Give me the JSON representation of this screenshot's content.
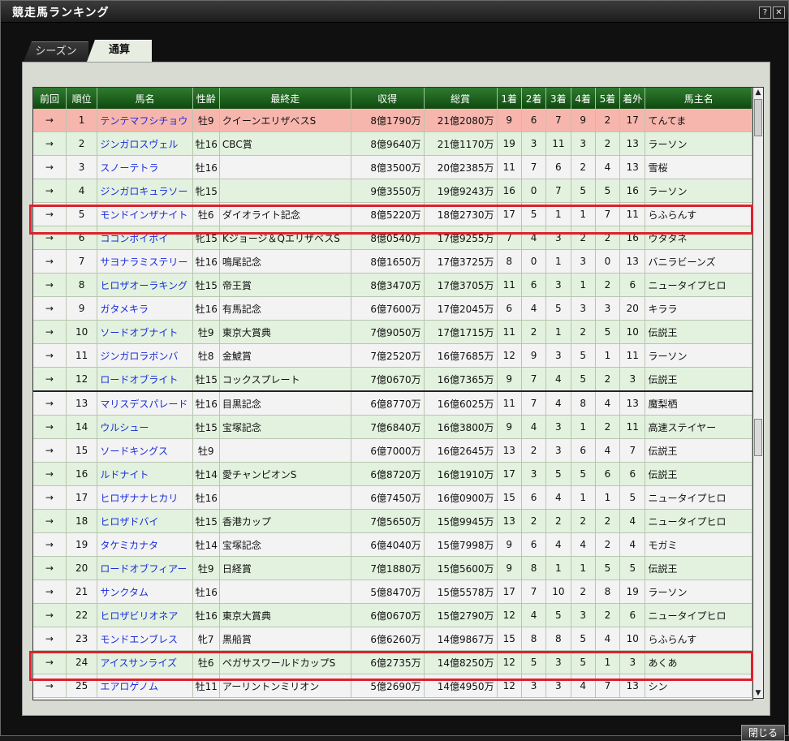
{
  "window": {
    "title": "競走馬ランキング",
    "help_label": "?",
    "close_label": "✕",
    "close_button": "閉じる"
  },
  "tabs": [
    {
      "label": "シーズン"
    },
    {
      "label": "通算"
    }
  ],
  "columns": [
    "前回",
    "順位",
    "馬名",
    "性齢",
    "最終走",
    "収得",
    "総賞",
    "1着",
    "2着",
    "3着",
    "4着",
    "5着",
    "着外",
    "馬主名"
  ],
  "rows": [
    {
      "prev": "→",
      "rank": "1",
      "name": "テンテマフシチョウ",
      "sexage": "牡9",
      "last": "クイーンエリザベスS",
      "earn": "8億1790万",
      "total": "21億2080万",
      "p1": "9",
      "p2": "6",
      "p3": "7",
      "p4": "9",
      "p5": "2",
      "out": "17",
      "owner": "てんてま"
    },
    {
      "prev": "→",
      "rank": "2",
      "name": "ジンガロスヴェル",
      "sexage": "牡16",
      "last": "CBC賞",
      "earn": "8億9640万",
      "total": "21億1170万",
      "p1": "19",
      "p2": "3",
      "p3": "11",
      "p4": "3",
      "p5": "2",
      "out": "13",
      "owner": "ラーソン"
    },
    {
      "prev": "→",
      "rank": "3",
      "name": "スノーテトラ",
      "sexage": "牡16",
      "last": "",
      "earn": "8億3500万",
      "total": "20億2385万",
      "p1": "11",
      "p2": "7",
      "p3": "6",
      "p4": "2",
      "p5": "4",
      "out": "13",
      "owner": "雪桜"
    },
    {
      "prev": "→",
      "rank": "4",
      "name": "ジンガロキュラソー",
      "sexage": "牝15",
      "last": "",
      "earn": "9億3550万",
      "total": "19億9243万",
      "p1": "16",
      "p2": "0",
      "p3": "7",
      "p4": "5",
      "p5": "5",
      "out": "16",
      "owner": "ラーソン"
    },
    {
      "prev": "→",
      "rank": "5",
      "name": "モンドインザナイト",
      "sexage": "牡6",
      "last": "ダイオライト記念",
      "earn": "8億5220万",
      "total": "18億2730万",
      "p1": "17",
      "p2": "5",
      "p3": "1",
      "p4": "1",
      "p5": "7",
      "out": "11",
      "owner": "らふらんす"
    },
    {
      "prev": "→",
      "rank": "6",
      "name": "ココンポイポイ",
      "sexage": "牝15",
      "last": "Kジョージ＆QエリザベスS",
      "earn": "8億0540万",
      "total": "17億9255万",
      "p1": "7",
      "p2": "4",
      "p3": "3",
      "p4": "2",
      "p5": "2",
      "out": "16",
      "owner": "ウタタネ"
    },
    {
      "prev": "→",
      "rank": "7",
      "name": "サヨナラミステリー",
      "sexage": "牡16",
      "last": "鳴尾記念",
      "earn": "8億1650万",
      "total": "17億3725万",
      "p1": "8",
      "p2": "0",
      "p3": "1",
      "p4": "3",
      "p5": "0",
      "out": "13",
      "owner": "バニラビーンズ"
    },
    {
      "prev": "→",
      "rank": "8",
      "name": "ヒロザオーラキング",
      "sexage": "牡15",
      "last": "帝王賞",
      "earn": "8億3470万",
      "total": "17億3705万",
      "p1": "11",
      "p2": "6",
      "p3": "3",
      "p4": "1",
      "p5": "2",
      "out": "6",
      "owner": "ニュータイプヒロ"
    },
    {
      "prev": "→",
      "rank": "9",
      "name": "ガタメキラ",
      "sexage": "牡16",
      "last": "有馬記念",
      "earn": "6億7600万",
      "total": "17億2045万",
      "p1": "6",
      "p2": "4",
      "p3": "5",
      "p4": "3",
      "p5": "3",
      "out": "20",
      "owner": "キララ"
    },
    {
      "prev": "→",
      "rank": "10",
      "name": "ソードオブナイト",
      "sexage": "牡9",
      "last": "東京大賞典",
      "earn": "7億9050万",
      "total": "17億1715万",
      "p1": "11",
      "p2": "2",
      "p3": "1",
      "p4": "2",
      "p5": "5",
      "out": "10",
      "owner": "伝説王"
    },
    {
      "prev": "→",
      "rank": "11",
      "name": "ジンガロラボンバ",
      "sexage": "牡8",
      "last": "金鯱賞",
      "earn": "7億2520万",
      "total": "16億7685万",
      "p1": "12",
      "p2": "9",
      "p3": "3",
      "p4": "5",
      "p5": "1",
      "out": "11",
      "owner": "ラーソン"
    },
    {
      "prev": "→",
      "rank": "12",
      "name": "ロードオブライト",
      "sexage": "牡15",
      "last": "コックスプレート",
      "earn": "7億0670万",
      "total": "16億7365万",
      "p1": "9",
      "p2": "7",
      "p3": "4",
      "p4": "5",
      "p5": "2",
      "out": "3",
      "owner": "伝説王"
    },
    {
      "prev": "→",
      "rank": "13",
      "name": "マリスデスパレード",
      "sexage": "牡16",
      "last": "目黒記念",
      "earn": "6億8770万",
      "total": "16億6025万",
      "p1": "11",
      "p2": "7",
      "p3": "4",
      "p4": "8",
      "p5": "4",
      "out": "13",
      "owner": "魔梨栖"
    },
    {
      "prev": "→",
      "rank": "14",
      "name": "ウルシュー",
      "sexage": "牡15",
      "last": "宝塚記念",
      "earn": "7億6840万",
      "total": "16億3800万",
      "p1": "9",
      "p2": "4",
      "p3": "3",
      "p4": "1",
      "p5": "2",
      "out": "11",
      "owner": "高速ステイヤー"
    },
    {
      "prev": "→",
      "rank": "15",
      "name": "ソードキングス",
      "sexage": "牡9",
      "last": "",
      "earn": "6億7000万",
      "total": "16億2645万",
      "p1": "13",
      "p2": "2",
      "p3": "3",
      "p4": "6",
      "p5": "4",
      "out": "7",
      "owner": "伝説王"
    },
    {
      "prev": "→",
      "rank": "16",
      "name": "ルドナイト",
      "sexage": "牡14",
      "last": "愛チャンピオンS",
      "earn": "6億8720万",
      "total": "16億1910万",
      "p1": "17",
      "p2": "3",
      "p3": "5",
      "p4": "5",
      "p5": "6",
      "out": "6",
      "owner": "伝説王"
    },
    {
      "prev": "→",
      "rank": "17",
      "name": "ヒロザナナヒカリ",
      "sexage": "牡16",
      "last": "",
      "earn": "6億7450万",
      "total": "16億0900万",
      "p1": "15",
      "p2": "6",
      "p3": "4",
      "p4": "1",
      "p5": "1",
      "out": "5",
      "owner": "ニュータイプヒロ"
    },
    {
      "prev": "→",
      "rank": "18",
      "name": "ヒロザドバイ",
      "sexage": "牡15",
      "last": "香港カップ",
      "earn": "7億5650万",
      "total": "15億9945万",
      "p1": "13",
      "p2": "2",
      "p3": "2",
      "p4": "2",
      "p5": "2",
      "out": "4",
      "owner": "ニュータイプヒロ"
    },
    {
      "prev": "→",
      "rank": "19",
      "name": "タケミカナタ",
      "sexage": "牡14",
      "last": "宝塚記念",
      "earn": "6億4040万",
      "total": "15億7998万",
      "p1": "9",
      "p2": "6",
      "p3": "4",
      "p4": "4",
      "p5": "2",
      "out": "4",
      "owner": "モガミ"
    },
    {
      "prev": "→",
      "rank": "20",
      "name": "ロードオブフィアー",
      "sexage": "牡9",
      "last": "日経賞",
      "earn": "7億1880万",
      "total": "15億5600万",
      "p1": "9",
      "p2": "8",
      "p3": "1",
      "p4": "1",
      "p5": "5",
      "out": "5",
      "owner": "伝説王"
    },
    {
      "prev": "→",
      "rank": "21",
      "name": "サンクタム",
      "sexage": "牡16",
      "last": "",
      "earn": "5億8470万",
      "total": "15億5578万",
      "p1": "17",
      "p2": "7",
      "p3": "10",
      "p4": "2",
      "p5": "8",
      "out": "19",
      "owner": "ラーソン"
    },
    {
      "prev": "→",
      "rank": "22",
      "name": "ヒロザビリオネア",
      "sexage": "牡16",
      "last": "東京大賞典",
      "earn": "6億0670万",
      "total": "15億2790万",
      "p1": "12",
      "p2": "4",
      "p3": "5",
      "p4": "3",
      "p5": "2",
      "out": "6",
      "owner": "ニュータイプヒロ"
    },
    {
      "prev": "→",
      "rank": "23",
      "name": "モンドエンブレス",
      "sexage": "牝7",
      "last": "黒船賞",
      "earn": "6億6260万",
      "total": "14億9867万",
      "p1": "15",
      "p2": "8",
      "p3": "8",
      "p4": "5",
      "p5": "4",
      "out": "10",
      "owner": "らふらんす"
    },
    {
      "prev": "→",
      "rank": "24",
      "name": "アイスサンライズ",
      "sexage": "牡6",
      "last": "ペガサスワールドカップS",
      "earn": "6億2735万",
      "total": "14億8250万",
      "p1": "12",
      "p2": "5",
      "p3": "3",
      "p4": "5",
      "p5": "1",
      "out": "3",
      "owner": "あくあ"
    },
    {
      "prev": "→",
      "rank": "25",
      "name": "エアロゲノム",
      "sexage": "牡11",
      "last": "アーリントンミリオン",
      "earn": "5億2690万",
      "total": "14億4950万",
      "p1": "12",
      "p2": "3",
      "p3": "3",
      "p4": "4",
      "p5": "7",
      "out": "13",
      "owner": "シン"
    }
  ]
}
